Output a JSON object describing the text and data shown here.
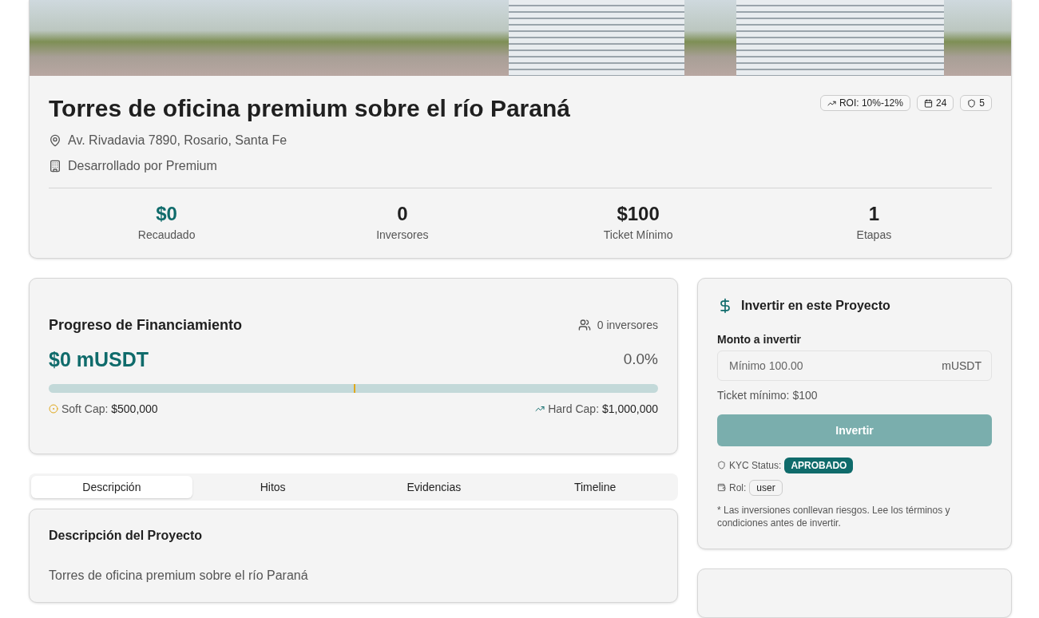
{
  "project": {
    "title": "Torres de oficina premium sobre el río Paraná",
    "address": "Av. Rivadavia 7890, Rosario, Santa Fe",
    "developer": "Desarrollado por Premium",
    "badges": [
      {
        "kind": "roi",
        "label": "ROI: 10%-12%"
      },
      {
        "kind": "calendar",
        "label": "24"
      },
      {
        "kind": "shield",
        "label": "5"
      }
    ],
    "stats": [
      {
        "value": "$0",
        "label": "Recaudado",
        "accent": true
      },
      {
        "value": "0",
        "label": "Inversores",
        "accent": false
      },
      {
        "value": "$100",
        "label": "Ticket Mínimo",
        "accent": false
      },
      {
        "value": "1",
        "label": "Etapas",
        "accent": false
      }
    ]
  },
  "funding": {
    "title": "Progreso de Financiamiento",
    "investors": "0 inversores",
    "raised": "$0 mUSDT",
    "percent": "0.0%",
    "level": 0,
    "soft_cap": {
      "label": "Soft Cap:",
      "value": "$500,000",
      "level": 0.5
    },
    "hard_cap": {
      "label": "Hard Cap:",
      "value": "$1,000,000"
    }
  },
  "tabs": [
    {
      "label": "Descripción",
      "selected": true
    },
    {
      "label": "Hitos",
      "selected": false
    },
    {
      "label": "Evidencias",
      "selected": false
    },
    {
      "label": "Timeline",
      "selected": false
    }
  ],
  "description": {
    "title": "Descripción del Proyecto",
    "text": "Torres de oficina premium sobre el río Paraná"
  },
  "invest": {
    "title": "Invertir en este Proyecto",
    "field_label": "Monto a invertir",
    "placeholder": "Mínimo 100.00",
    "unit": "mUSDT",
    "min_ticket": "Ticket mínimo: $100",
    "button": "Invertir",
    "button_disabled": true,
    "kyc_label": "KYC Status:",
    "kyc_status": "APROBADO",
    "role_label": "Rol:",
    "role": "user",
    "disclaimer": "* Las inversiones conllevan riesgos. Lee los términos y condiciones antes de invertir."
  }
}
